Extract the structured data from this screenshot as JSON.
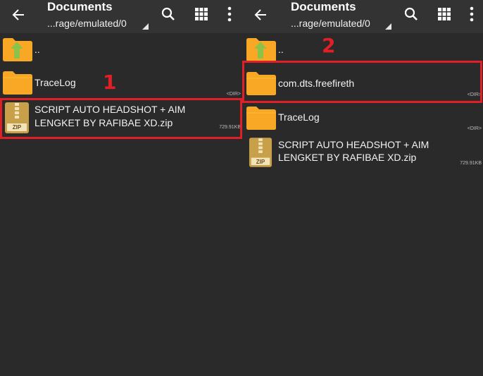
{
  "panels": [
    {
      "toolbar": {
        "title": "Documents",
        "path": "...rage/emulated/0"
      },
      "files": [
        {
          "type": "parent",
          "name": "..",
          "meta": ""
        },
        {
          "type": "folder",
          "name": "TraceLog",
          "meta": "<DIR>"
        },
        {
          "type": "zip",
          "name_line1": "SCRIPT AUTO HEADSHOT + AIM",
          "name_line2": "LENGKET BY RAFIBAE XD.zip",
          "meta": "729.91KB",
          "zip_label": "ZIP"
        }
      ],
      "annotation": "1"
    },
    {
      "toolbar": {
        "title": "Documents",
        "path": "...rage/emulated/0"
      },
      "files": [
        {
          "type": "parent",
          "name": "..",
          "meta": ""
        },
        {
          "type": "folder",
          "name": "com.dts.freefireth",
          "meta": "<DIR>"
        },
        {
          "type": "folder",
          "name": "TraceLog",
          "meta": "<DIR>"
        },
        {
          "type": "zip",
          "name_line1": "SCRIPT AUTO HEADSHOT + AIM",
          "name_line2": "LENGKET BY RAFIBAE XD.zip",
          "meta": "729.91KB",
          "zip_label": "ZIP"
        }
      ],
      "annotation": "2"
    }
  ],
  "colors": {
    "background": "#2a2a2a",
    "toolbar": "#333333",
    "folder": "#f9a825",
    "parent_arrow": "#8bc34a",
    "zip": "#c9a04a",
    "annotation": "#e01f26"
  }
}
